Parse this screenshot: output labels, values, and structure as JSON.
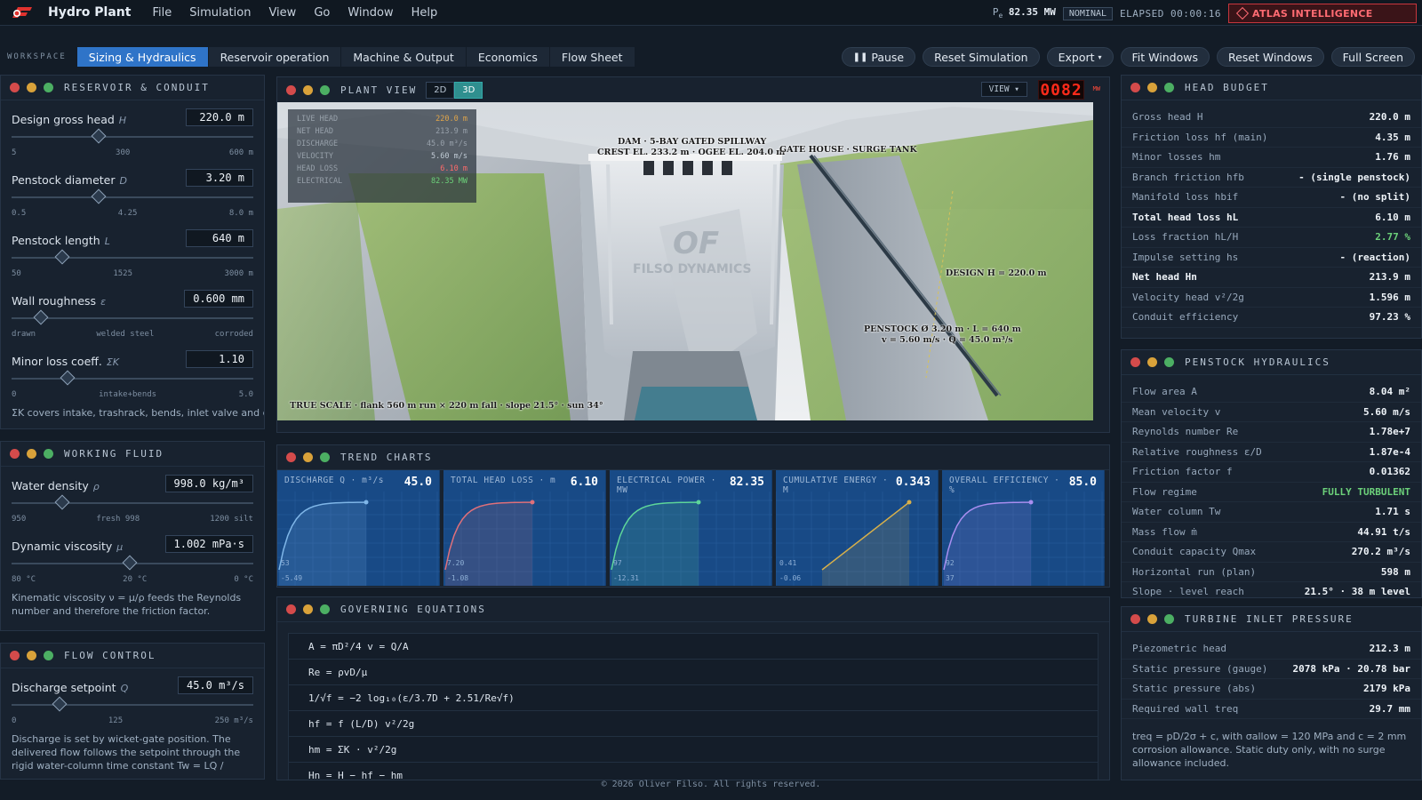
{
  "app": {
    "title": "Hydro Plant",
    "brand_color": "#e0322e"
  },
  "menu": [
    "File",
    "Simulation",
    "View",
    "Go",
    "Window",
    "Help"
  ],
  "status": {
    "pe_label": "P",
    "pe_sub": "e",
    "pe_value": "82.35 MW",
    "state": "NOMINAL",
    "elapsed": "ELAPSED 00:00:16",
    "atlas": "ATLAS INTELLIGENCE"
  },
  "toolbar": {
    "workspace_label": "WORKSPACE",
    "tabs": [
      "Sizing & Hydraulics",
      "Reservoir operation",
      "Machine & Output",
      "Economics",
      "Flow Sheet"
    ],
    "active_tab": "Sizing & Hydraulics",
    "pause": "Pause",
    "reset_sim": "Reset Simulation",
    "export": "Export",
    "fit": "Fit Windows",
    "reset_win": "Reset Windows",
    "full": "Full Screen"
  },
  "reservoir": {
    "title": "RESERVOIR & CONDUIT",
    "params": [
      {
        "label": "Design gross head",
        "sym": "H",
        "value": "220.0 m",
        "ticks": [
          "5",
          "300",
          "600 m"
        ],
        "level": 0.36
      },
      {
        "label": "Penstock diameter",
        "sym": "D",
        "value": "3.20 m",
        "ticks": [
          "0.5",
          "4.25",
          "8.0 m"
        ],
        "level": 0.36
      },
      {
        "label": "Penstock length",
        "sym": "L",
        "value": "640 m",
        "ticks": [
          "50",
          "1525",
          "3000 m"
        ],
        "level": 0.21
      },
      {
        "label": "Wall roughness",
        "sym": "ε",
        "value": "0.600 mm",
        "ticks": [
          "drawn",
          "welded steel",
          "corroded"
        ],
        "level": 0.12
      },
      {
        "label": "Minor loss coeff.",
        "sym": "ΣK",
        "value": "1.10",
        "ticks": [
          "0",
          "intake+bends",
          "5.0"
        ],
        "level": 0.23
      }
    ],
    "note": "ΣK covers intake, trashrack, bends, inlet valve and draft-"
  },
  "fluid": {
    "title": "WORKING FLUID",
    "params": [
      {
        "label": "Water density",
        "sym": "ρ",
        "value": "998.0 kg/m³",
        "ticks": [
          "950",
          "fresh 998",
          "1200 silt"
        ],
        "level": 0.21
      },
      {
        "label": "Dynamic viscosity",
        "sym": "μ",
        "value": "1.002 mPa·s",
        "ticks": [
          "80 °C",
          "20 °C",
          "0 °C"
        ],
        "level": 0.49
      }
    ],
    "note": "Kinematic viscosity ν = μ/ρ feeds the Reynolds number and therefore the friction factor."
  },
  "flow": {
    "title": "FLOW CONTROL",
    "params": [
      {
        "label": "Discharge setpoint",
        "sym": "Q",
        "value": "45.0 m³/s",
        "ticks": [
          "0",
          "125",
          "250 m³/s"
        ],
        "level": 0.2
      }
    ],
    "note": "Discharge is set by wicket-gate position. The delivered flow follows the setpoint through the rigid water-column time constant Tw = LQ / (gA·Hn)."
  },
  "plant": {
    "title": "PLANT VIEW",
    "mode_2d": "2D",
    "mode_3d": "3D",
    "view_btn": "VIEW",
    "counter": "0082",
    "counter_unit": "MW",
    "overlay": [
      {
        "k": "LIVE HEAD",
        "v": "220.0 m",
        "c": "#e0a54a"
      },
      {
        "k": "NET HEAD",
        "v": "213.9 m",
        "c": "#c2ccd6"
      },
      {
        "k": "DISCHARGE",
        "v": "45.0 m³/s",
        "c": "#c2ccd6"
      },
      {
        "k": "VELOCITY",
        "v": "5.60 m/s",
        "c": "#c2ccd6"
      },
      {
        "k": "HEAD LOSS",
        "v": "6.10 m",
        "c": "#ff6b6b"
      },
      {
        "k": "ELECTRICAL",
        "v": "82.35 MW",
        "c": "#6cd17a"
      }
    ],
    "labels": {
      "dam": "DAM · 5-BAY GATED SPILLWAY",
      "crest": "CREST EL. 233.2 m · OGEE EL. 204.0 m",
      "gate": "GATE HOUSE · SURGE TANK",
      "design": "DESIGN H = 220.0 m",
      "penstock1": "PENSTOCK  Ø 3.20 m  ·  L = 640 m",
      "penstock2": "v = 5.60 m/s  ·  Q = 45.0 m³/s",
      "scale": "TRUE SCALE · flank 560 m run × 220 m fall  ·  slope 21.5°  ·  sun 34°",
      "logo": "OF",
      "logo_text": "FILSO DYNAMICS"
    }
  },
  "trends": {
    "title": "TREND CHARTS",
    "charts": [
      {
        "label": "DISCHARGE Q · m³/s",
        "value": "45.0",
        "color": "#7fb6e8",
        "top": "53",
        "bottom": "-5.49",
        "shape": "rise"
      },
      {
        "label": "TOTAL HEAD LOSS · m",
        "value": "6.10",
        "color": "#e0707a",
        "top": "7.20",
        "bottom": "-1.08",
        "shape": "rise"
      },
      {
        "label": "ELECTRICAL POWER · MW",
        "value": "82.35",
        "color": "#5ed69a",
        "top": "97",
        "bottom": "-12.31",
        "shape": "rise"
      },
      {
        "label": "CUMULATIVE ENERGY · M",
        "value": "0.343",
        "color": "#d8b04a",
        "top": "0.41",
        "bottom": "-0.06",
        "shape": "linear"
      },
      {
        "label": "OVERALL EFFICIENCY · %",
        "value": "85.0",
        "color": "#a98ef0",
        "top": "92",
        "bottom": "37",
        "shape": "rise"
      }
    ]
  },
  "equations": {
    "title": "GOVERNING EQUATIONS",
    "rows": [
      "A = πD²/4    v = Q/A",
      "Re = ρvD/μ",
      "1/√f = −2 log₁₀(ε/3.7D + 2.51/Re√f)",
      "hf = f (L/D) v²/2g",
      "hm = ΣK · v²/2g",
      "Hn = H − hf − hm"
    ]
  },
  "head_budget": {
    "title": "HEAD BUDGET",
    "rows": [
      {
        "k": "Gross head H",
        "v": "220.0 m"
      },
      {
        "k": "Friction loss hf (main)",
        "v": "4.35 m"
      },
      {
        "k": "Minor losses hm",
        "v": "1.76 m"
      },
      {
        "k": "Branch friction hfb",
        "v": "- (single penstock)"
      },
      {
        "k": "Manifold loss hbif",
        "v": "- (no split)"
      },
      {
        "k": "Total head loss hL",
        "v": "6.10 m",
        "bold": true
      },
      {
        "k": "Loss fraction hL/H",
        "v": "2.77 %",
        "green": true
      },
      {
        "k": "Impulse setting hs",
        "v": "- (reaction)"
      },
      {
        "k": "Net head Hn",
        "v": "213.9 m",
        "bold": true
      },
      {
        "k": "Velocity head v²/2g",
        "v": "1.596 m"
      },
      {
        "k": "Conduit efficiency",
        "v": "97.23 %"
      }
    ]
  },
  "penstock": {
    "title": "PENSTOCK HYDRAULICS",
    "rows": [
      {
        "k": "Flow area A",
        "v": "8.04 m²"
      },
      {
        "k": "Mean velocity v",
        "v": "5.60 m/s"
      },
      {
        "k": "Reynolds number Re",
        "v": "1.78e+7"
      },
      {
        "k": "Relative roughness ε/D",
        "v": "1.87e-4"
      },
      {
        "k": "Friction factor f",
        "v": "0.01362"
      },
      {
        "k": "Flow regime",
        "v": "FULLY TURBULENT",
        "green": true
      },
      {
        "k": "Water column Tw",
        "v": "1.71 s"
      },
      {
        "k": "Mass flow ṁ",
        "v": "44.91 t/s"
      },
      {
        "k": "Conduit capacity Qmax",
        "v": "270.2 m³/s"
      },
      {
        "k": "Horizontal run (plan)",
        "v": "598 m"
      },
      {
        "k": "Slope · level reach",
        "v": "21.5° · 38 m level"
      }
    ]
  },
  "turbine": {
    "title": "TURBINE INLET PRESSURE",
    "rows": [
      {
        "k": "Piezometric head",
        "v": "212.3 m"
      },
      {
        "k": "Static pressure (gauge)",
        "v": "2078 kPa · 20.78 bar"
      },
      {
        "k": "Static pressure (abs)",
        "v": "2179 kPa"
      },
      {
        "k": "Required wall treq",
        "v": "29.7 mm"
      }
    ],
    "note": "treq = pD/2σ + c, with σallow = 120 MPa and c = 2 mm corrosion allowance. Static duty only, with no surge allowance included."
  },
  "footer": "© 2026 Oliver Filso. All rights reserved."
}
